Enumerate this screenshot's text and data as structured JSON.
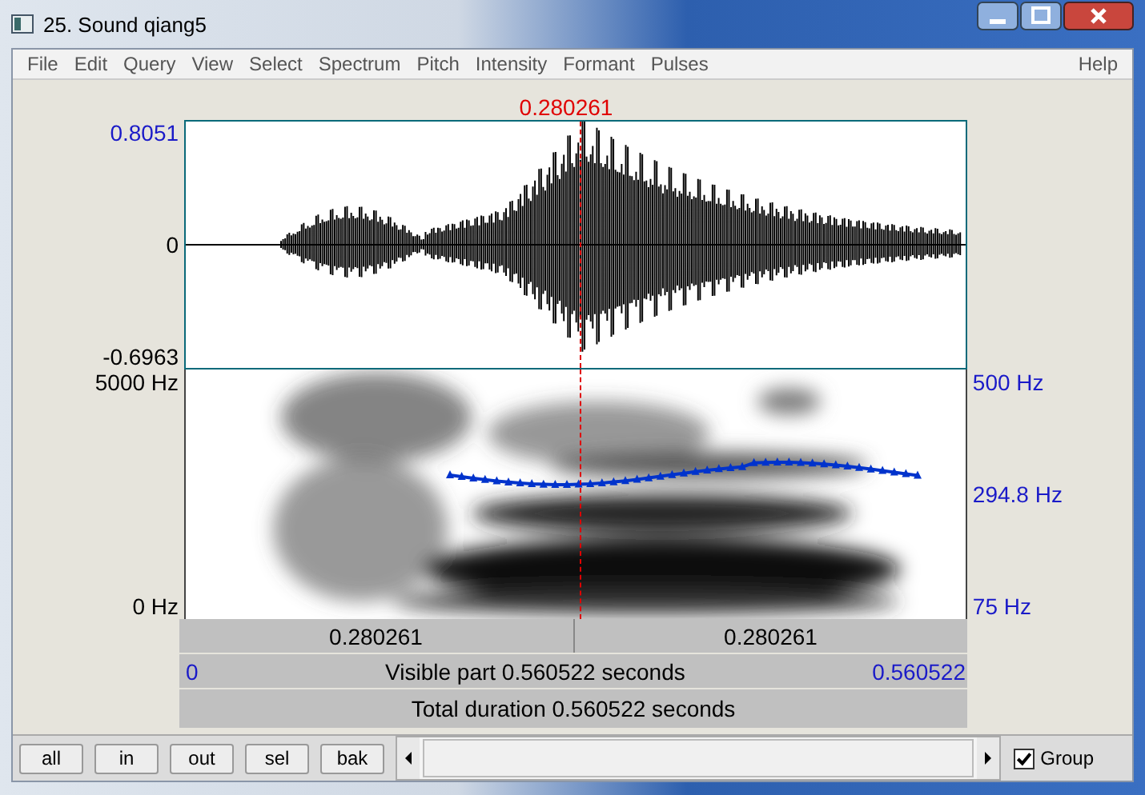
{
  "window": {
    "title": "25. Sound qiang5"
  },
  "menu": [
    "File",
    "Edit",
    "Query",
    "View",
    "Select",
    "Spectrum",
    "Pitch",
    "Intensity",
    "Formant",
    "Pulses"
  ],
  "help_menu": "Help",
  "cursor_time": "0.280261",
  "waveform": {
    "y_max": "0.8051",
    "y_zero": "0",
    "y_min": "-0.6963"
  },
  "spectrogram": {
    "left_labels": [
      "5000 Hz",
      "0 Hz"
    ],
    "right_labels": [
      "500 Hz",
      "294.8 Hz",
      "75 Hz"
    ]
  },
  "segments": [
    "0.280261",
    "0.280261"
  ],
  "visible": {
    "start": "0",
    "label": "Visible part 0.560522 seconds",
    "end": "0.560522"
  },
  "total": "Total duration 0.560522 seconds",
  "buttons": [
    "all",
    "in",
    "out",
    "sel",
    "bak"
  ],
  "group": {
    "label": "Group",
    "checked": true
  }
}
